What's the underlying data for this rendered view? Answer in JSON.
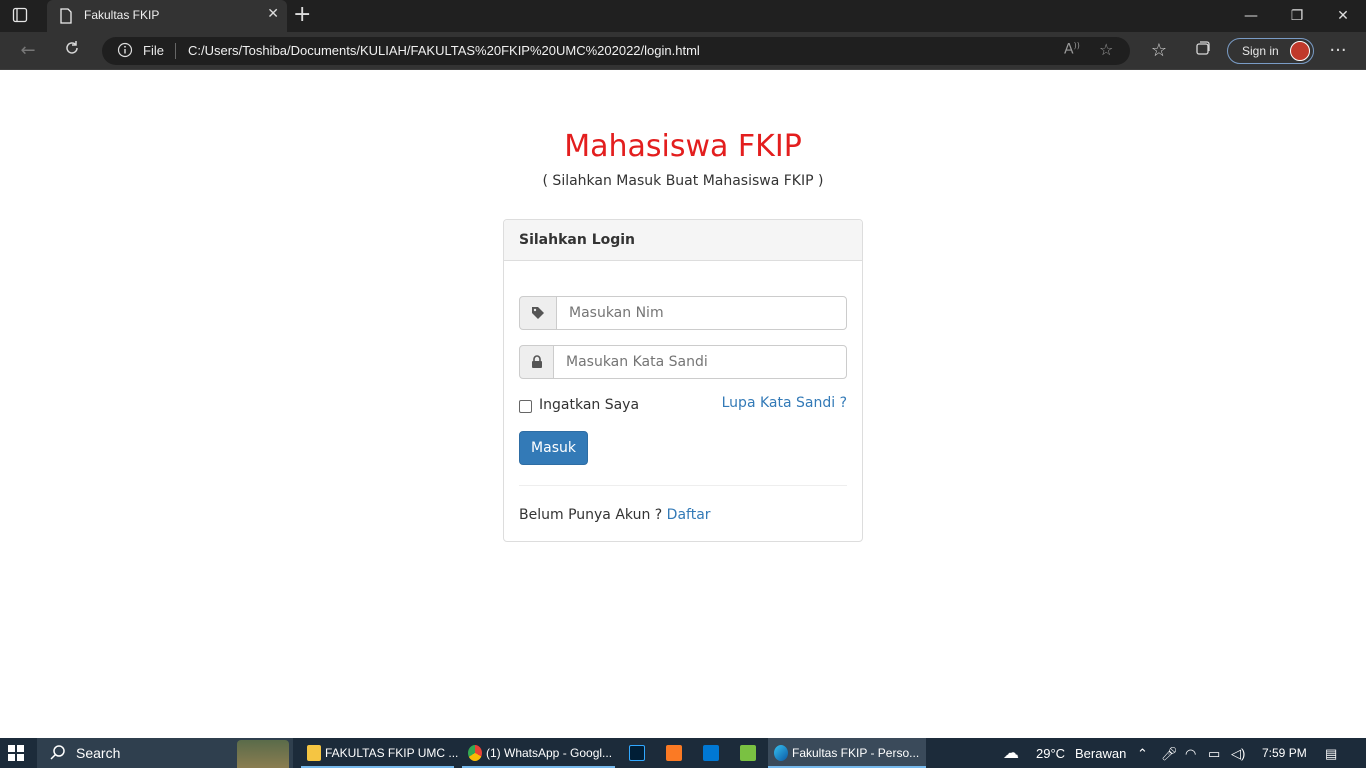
{
  "browser": {
    "tab_title": "Fakultas FKIP",
    "tab_close": "✕",
    "new_tab": "+",
    "address_scheme": "File",
    "address_url": "C:/Users/Toshiba/Documents/KULIAH/FAKULTAS%20FKIP%20UMC%202022/login.html",
    "sign_in_label": "Sign in",
    "window_controls": {
      "minimize": "—",
      "restore": "❐",
      "close": "✕"
    }
  },
  "page": {
    "heading": "Mahasiswa FKIP",
    "subheading": "( Silahkan Masuk Buat Mahasiswa FKIP )",
    "panel_title": "Silahkan Login",
    "nim_placeholder": "Masukan Nim",
    "password_placeholder": "Masukan Kata Sandi",
    "remember_label": "Ingatkan Saya",
    "remember_checked": false,
    "forgot_link": "Lupa Kata Sandi ?",
    "submit_label": "Masuk",
    "register_prompt": "Belum Punya Akun ?",
    "register_link": "Daftar",
    "colors": {
      "heading": "#e31e1e",
      "primary": "#337ab7",
      "link": "#337ab7"
    }
  },
  "taskbar": {
    "search_label": "Search",
    "tasks": [
      {
        "label": "FAKULTAS FKIP UMC ...",
        "icon": "folder-icon"
      },
      {
        "label": "(1) WhatsApp - Googl...",
        "icon": "chrome-icon"
      },
      {
        "label": "Fakultas FKIP - Perso...",
        "icon": "edge-icon"
      }
    ],
    "pinned_apps": [
      "photoshop-icon",
      "xampp-icon",
      "vscode-icon",
      "notepadpp-icon"
    ],
    "weather_temp": "29°C",
    "weather_text": "Berawan",
    "time": "7:59 PM"
  }
}
